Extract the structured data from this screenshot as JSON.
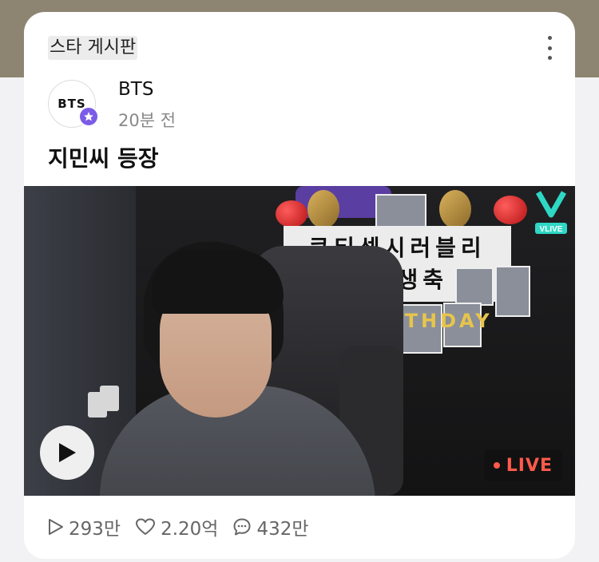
{
  "board": {
    "title": "스타 게시판"
  },
  "post": {
    "author": "BTS",
    "avatar_text": "BTS",
    "time": "20분 전",
    "title": "지민씨 등장"
  },
  "video": {
    "poster_line1": "쿠티섹시러블리",
    "poster_line2": "지민생축",
    "bday_text": "BIRTHDAY",
    "vlive_label": "VLIVE",
    "live_label": "LIVE"
  },
  "stats": {
    "plays": "293만",
    "likes": "2.20억",
    "comments": "432만"
  },
  "icons": [
    "kebab-menu-icon",
    "star-badge-icon",
    "play-icon",
    "heart-icon",
    "comment-icon",
    "play-count-icon",
    "vlive-logo"
  ],
  "colors": {
    "accent": "#7b5ce6",
    "live": "#ff5a4a",
    "top_band": "#8d8572"
  }
}
